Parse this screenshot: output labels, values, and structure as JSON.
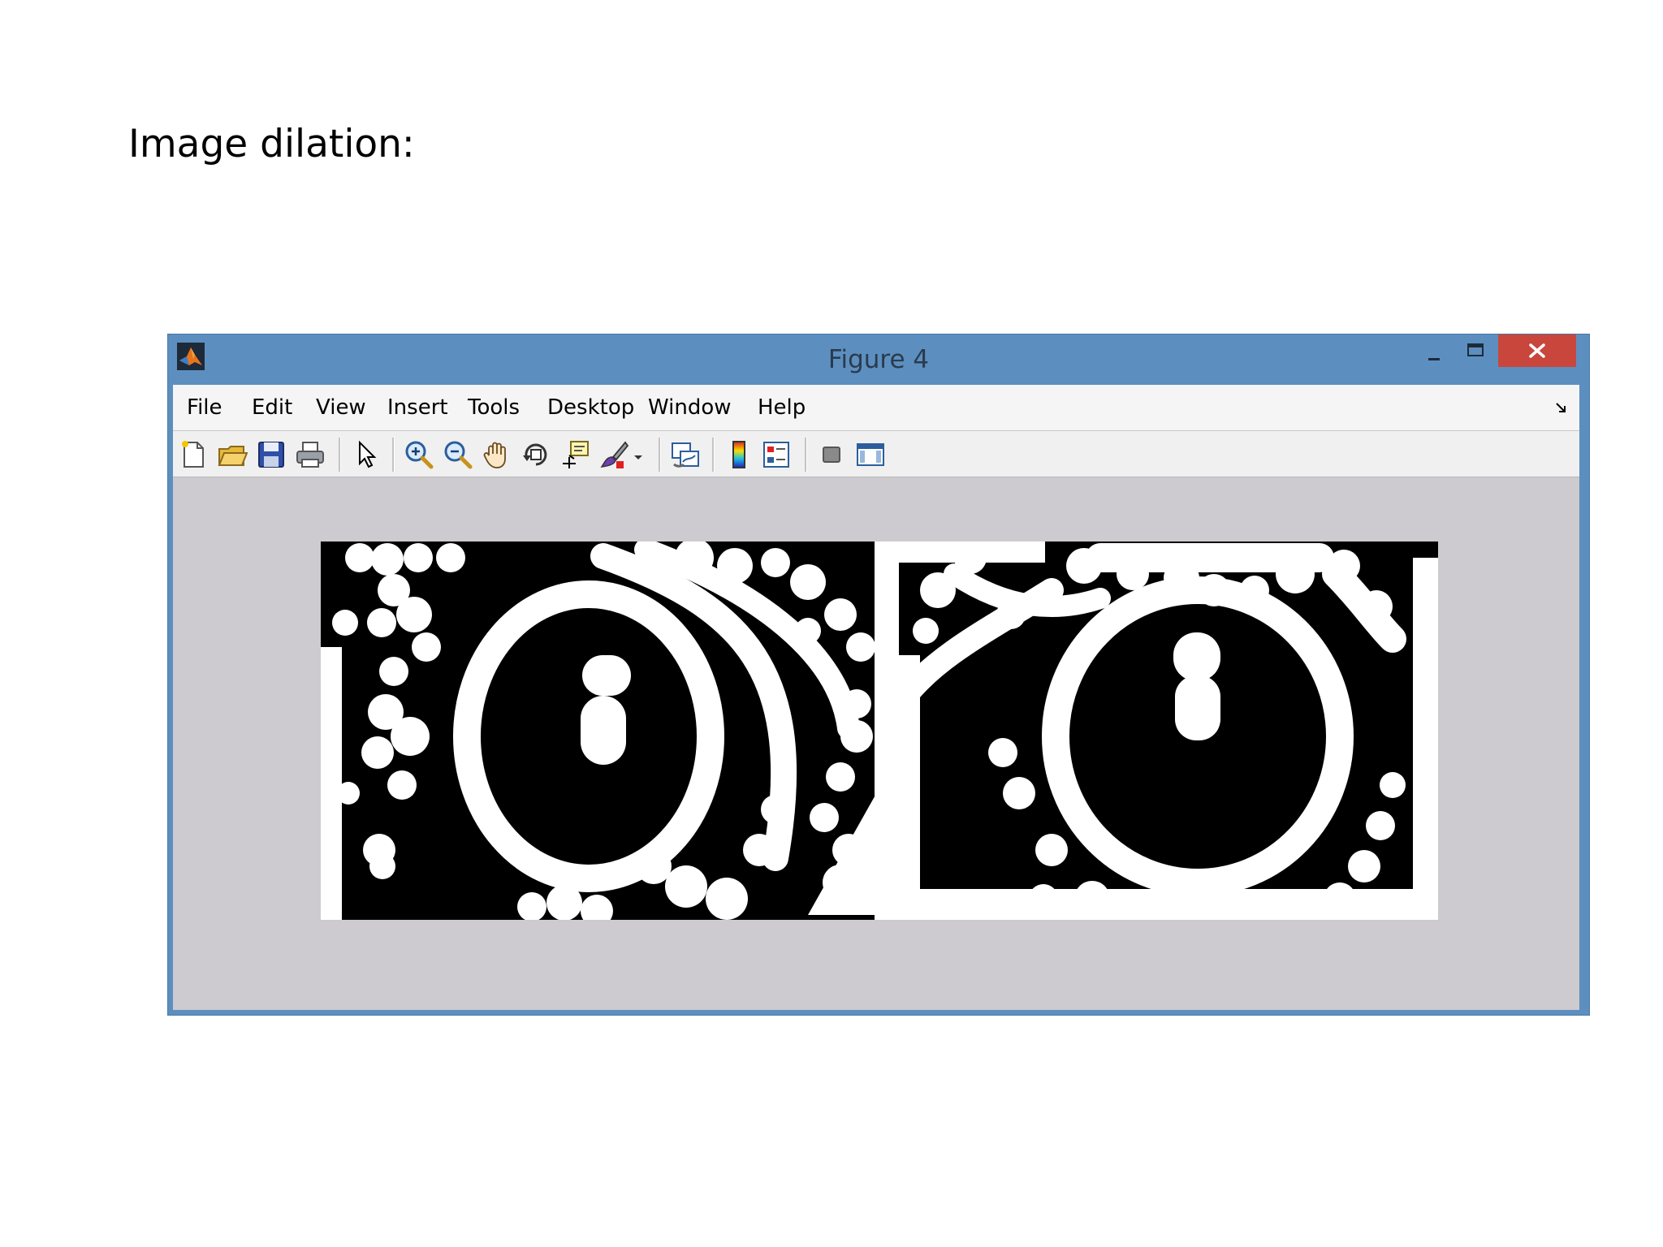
{
  "slide": {
    "heading": "Image dilation:"
  },
  "window": {
    "title": "Figure 4",
    "controls": {
      "minimize": "minimize",
      "maximize": "maximize",
      "close": "close"
    }
  },
  "menu": {
    "items": [
      "File",
      "Edit",
      "View",
      "Insert",
      "Tools",
      "Desktop",
      "Window",
      "Help"
    ]
  },
  "toolbar": {
    "buttons": [
      "new-figure-icon",
      "open-file-icon",
      "save-icon",
      "print-icon",
      "pointer-icon",
      "zoom-in-icon",
      "zoom-out-icon",
      "pan-icon",
      "rotate-3d-icon",
      "data-cursor-icon",
      "brush-icon",
      "brush-dropdown-icon",
      "link-plot-icon",
      "colorbar-icon",
      "legend-icon",
      "hide-plot-tools-icon",
      "show-plot-tools-icon"
    ]
  },
  "colors": {
    "title_bar": "#5c8fbf",
    "close_button": "#c9463d",
    "figure_background": "#cdcbcf",
    "image_foreground": "#ffffff",
    "image_background": "#000000"
  }
}
